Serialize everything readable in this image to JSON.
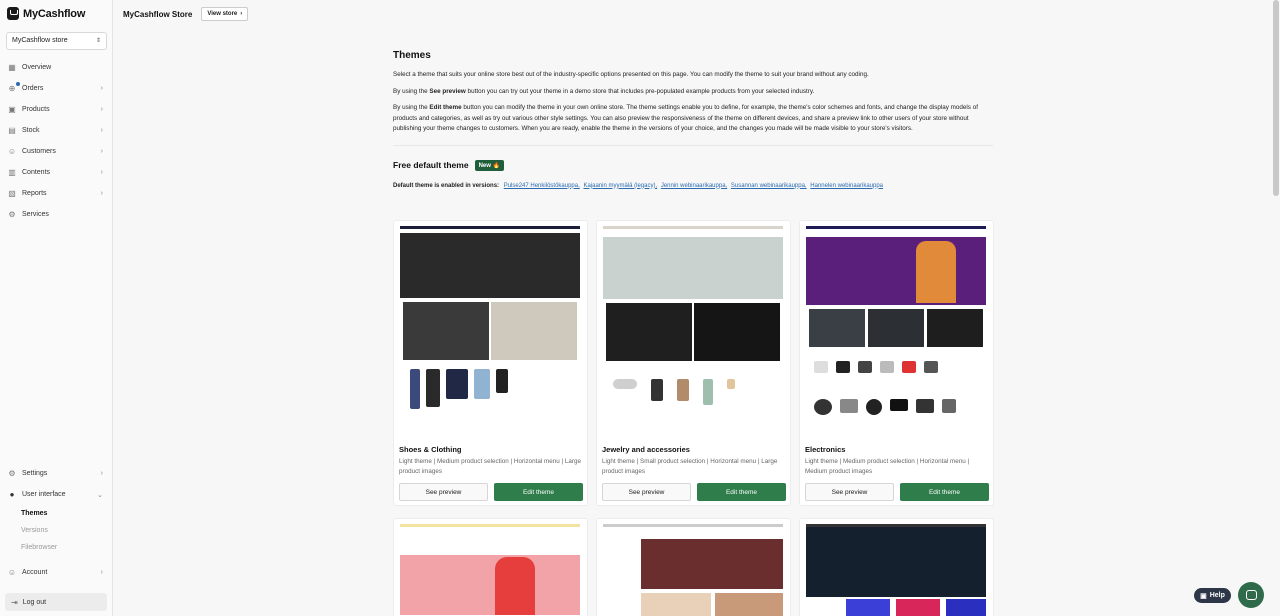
{
  "app": {
    "logo_text": "MyCashflow",
    "store_select": "MyCashflow store"
  },
  "sidebar": {
    "items": [
      {
        "label": "Overview",
        "icon": "chart-icon"
      },
      {
        "label": "Orders",
        "icon": "cart-icon"
      },
      {
        "label": "Products",
        "icon": "box-icon"
      },
      {
        "label": "Stock",
        "icon": "stock-icon"
      },
      {
        "label": "Customers",
        "icon": "users-icon"
      },
      {
        "label": "Contents",
        "icon": "contents-icon"
      },
      {
        "label": "Reports",
        "icon": "reports-icon"
      },
      {
        "label": "Services",
        "icon": "services-icon"
      }
    ],
    "bottom": {
      "settings": "Settings",
      "user_interface": "User interface",
      "sub": [
        "Themes",
        "Versions",
        "Filebrowser"
      ],
      "account": "Account",
      "logout": "Log out"
    }
  },
  "topbar": {
    "title": "MyCashflow Store",
    "view_store": "View store"
  },
  "page": {
    "title": "Themes",
    "intro": "Select a theme that suits your online store best out of the industry-specific options presented on this page. You can modify the theme to suit your brand without any coding.",
    "p2_pre": "By using the ",
    "p2_bold": "See preview",
    "p2_post": " button you can try out your theme in a demo store that includes pre-populated example products from your selected industry.",
    "p3_pre": "By using the ",
    "p3_bold": "Edit theme",
    "p3_post": " button you can modify the theme in your own online store. The theme settings enable you to define, for example, the theme's color schemes and fonts, and change the display models of products and categories, as well as try out various other style settings. You can also preview the responsiveness of the theme on different devices, and share a preview link to other users of your store without publishing your theme changes to customers. When you are ready, enable the theme in the versions of your choice, and the changes you made will be made visible to your store's visitors.",
    "section_title": "Free default theme",
    "badge": "New 🔥",
    "versions_label": "Default theme is enabled in versions:",
    "versions": [
      "Pulse247 Henkilöstökauppa,",
      "Kajaanin myymälä (legacy),",
      "Jennin webinaarikauppa,",
      "Susannan webinaarikauppa,",
      "Hannelen webinaarikauppa"
    ]
  },
  "themes": [
    {
      "name": "Shoes & Clothing",
      "desc": "Light theme | Medium product selection | Horizontal menu | Large product images",
      "see": "See preview",
      "edit": "Edit theme"
    },
    {
      "name": "Jewelry and accessories",
      "desc": "Light theme | Small product selection | Horizontal menu | Large product images",
      "see": "See preview",
      "edit": "Edit theme"
    },
    {
      "name": "Electronics",
      "desc": "Light theme | Medium product selection | Horizontal menu | Medium product images",
      "see": "See preview",
      "edit": "Edit theme"
    }
  ],
  "widgets": {
    "help": "Help"
  },
  "colors": {
    "accent_green": "#2e7d4a",
    "badge_green": "#1f5e3a",
    "link_blue": "#2b6cb0"
  }
}
